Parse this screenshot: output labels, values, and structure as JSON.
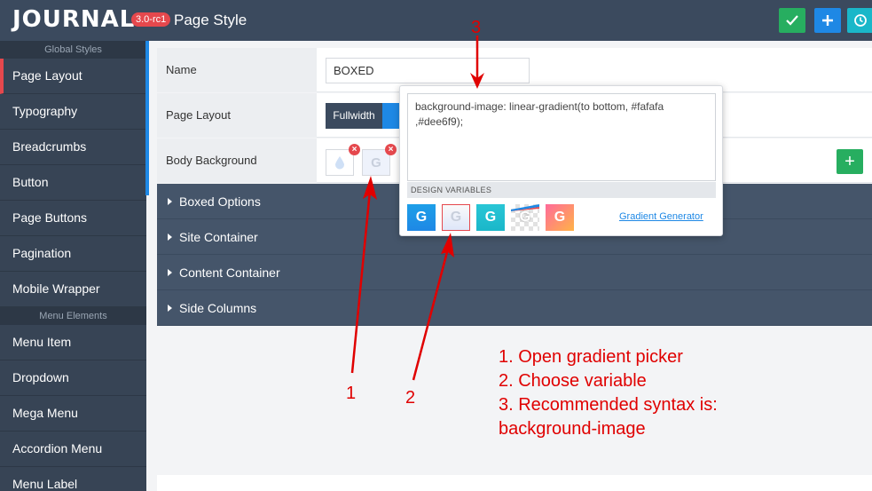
{
  "app": {
    "logo": "JOURNAL",
    "version": "3.0-rc1",
    "page_title": "Page Style"
  },
  "toolbar": {
    "save_icon": "check-icon",
    "add_icon": "plus-icon",
    "history_icon": "history-icon",
    "colors": {
      "save": "#27ae60",
      "add": "#1e88e5",
      "history": "#1ab7c9"
    }
  },
  "sidebar": {
    "sections": [
      {
        "title": "Global Styles",
        "items": [
          "Page Layout",
          "Typography",
          "Breadcrumbs",
          "Button",
          "Page Buttons",
          "Pagination",
          "Mobile Wrapper"
        ]
      },
      {
        "title": "Menu Elements",
        "items": [
          "Menu Item",
          "Dropdown",
          "Mega Menu",
          "Accordion Menu",
          "Menu Label"
        ]
      }
    ],
    "active": "Page Layout"
  },
  "form": {
    "name_label": "Name",
    "name_value": "BOXED",
    "layout_label": "Page Layout",
    "layout_option_fullwidth": "Fullwidth",
    "body_bg_label": "Body Background",
    "remove_glyph": "×",
    "add_glyph": "+"
  },
  "accordions": [
    "Boxed Options",
    "Site Container",
    "Content Container",
    "Side Columns"
  ],
  "popover": {
    "css_value": "background-image: linear-gradient(to bottom, #fafafa ,#dee6f9);",
    "design_variables_label": "DESIGN VARIABLES",
    "swatch_letter": "G",
    "gradient_link": "Gradient Generator"
  },
  "annotations": {
    "marker_1": "1",
    "marker_2": "2",
    "marker_3": "3",
    "steps": [
      "1. Open gradient picker",
      "2. Choose variable",
      "3. Recommended syntax is:",
      "background-image"
    ]
  }
}
